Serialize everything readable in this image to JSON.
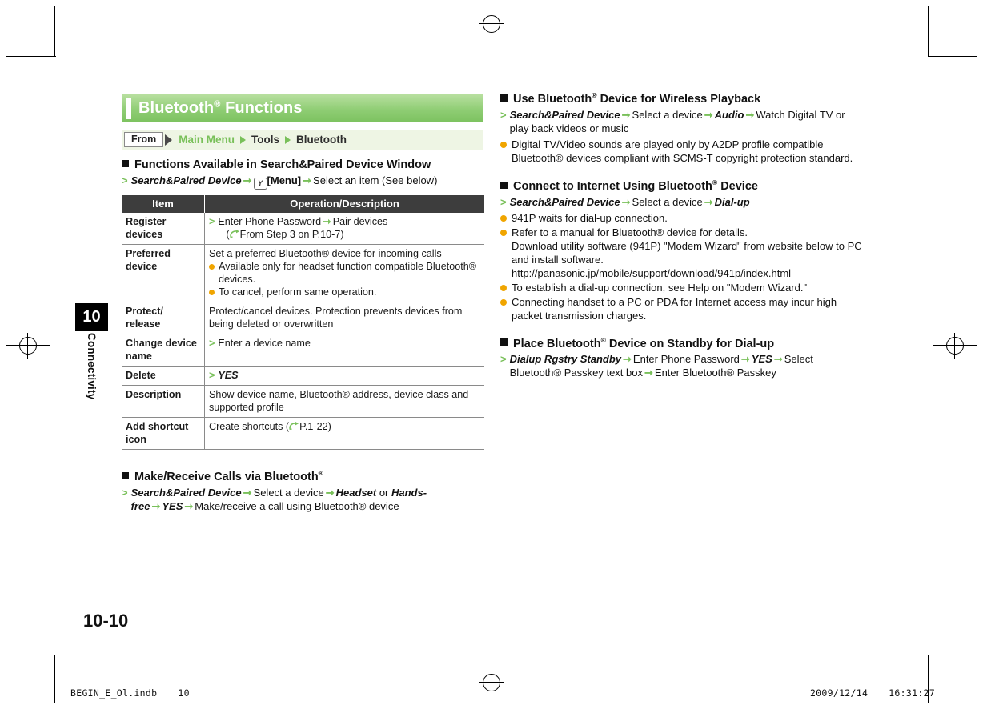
{
  "header": {
    "title": "Bluetooth",
    "title_sup": "®",
    "title_tail": " Functions"
  },
  "from_bar": {
    "label": "From",
    "path_1": "Main Menu",
    "path_2": "Tools",
    "path_3": "Bluetooth"
  },
  "side_tab": {
    "chapter_number": "10",
    "chapter_label": "Connectivity"
  },
  "left": {
    "heading_1": "Functions Available in Search&Paired Device Window",
    "step_1": {
      "bold_italic": "Search&Paired Device",
      "icon": "menu-key-icon",
      "menu_label": "[Menu]",
      "tail": "Select an item (See below)"
    },
    "table": {
      "headers": [
        "Item",
        "Operation/Description"
      ],
      "rows": [
        {
          "item": "Register devices",
          "desc_type": "step",
          "desc": "Enter Phone Password",
          "desc_tail": "Pair devices",
          "desc_ref": "From Step 3 on P.10-7)"
        },
        {
          "item": "Preferred device",
          "desc_type": "text-bullets",
          "desc": "Set a preferred Bluetooth® device for incoming calls",
          "bullets": [
            "Available only for headset function compatible Bluetooth® devices.",
            "To cancel, perform same operation."
          ]
        },
        {
          "item": "Protect/ release",
          "desc_type": "text",
          "desc": "Protect/cancel devices. Protection prevents devices from being deleted or overwritten"
        },
        {
          "item": "Change device name",
          "desc_type": "step-simple",
          "desc": "Enter a device name"
        },
        {
          "item": "Delete",
          "desc_type": "step-bolditalic",
          "desc": "YES"
        },
        {
          "item": "Description",
          "desc_type": "text",
          "desc": "Show device name, Bluetooth® address, device class and supported profile"
        },
        {
          "item": "Add shortcut icon",
          "desc_type": "text-ref",
          "desc": "Create shortcuts (",
          "desc_ref": "P.1-22)"
        }
      ]
    },
    "heading_2": "Make/Receive Calls via Bluetooth",
    "heading_2_sup": "®",
    "step_2": {
      "bold_italic": "Search&Paired Device",
      "mid": "Select a device",
      "opt_1": "Headset",
      "or": "or",
      "opt_2": "Hands-free",
      "opt_3": "YES",
      "tail": "Make/receive a call using Bluetooth® device"
    }
  },
  "right": {
    "heading_1": "Use Bluetooth",
    "heading_1_sup": "®",
    "heading_1_tail": " Device for Wireless Playback",
    "step_1": {
      "bold_italic": "Search&Paired Device",
      "mid": "Select a device",
      "opt": "Audio",
      "tail": "Watch Digital TV or play back videos or music"
    },
    "bullet_1": "Digital TV/Video sounds are played only by A2DP profile compatible Bluetooth® devices compliant with SCMS-T copyright protection standard.",
    "heading_2": "Connect to Internet Using Bluetooth",
    "heading_2_sup": "®",
    "heading_2_tail": " Device",
    "step_2": {
      "bold_italic": "Search&Paired Device",
      "mid": "Select a device",
      "opt": "Dial-up"
    },
    "bullet_2": "941P waits for dial-up connection.",
    "bullet_3_line1": "Refer to a manual for Bluetooth® device for details.",
    "bullet_3_line2": "Download utility software (941P) \"Modem Wizard\" from website below to PC and install software.",
    "bullet_3_line3": "http://panasonic.jp/mobile/support/download/941p/index.html",
    "bullet_4": "To establish a dial-up connection, see Help on \"Modem Wizard.\"",
    "bullet_5": "Connecting handset to a PC or PDA for Internet access may incur high packet transmission charges.",
    "heading_3": "Place Bluetooth",
    "heading_3_sup": "®",
    "heading_3_tail": " Device on Standby for Dial-up",
    "step_3": {
      "bold_italic": "Dialup Rgstry Standby",
      "mid": "Enter Phone Password",
      "opt": "YES",
      "tail_1": "Select Bluetooth® Passkey text box",
      "tail_2": "Enter Bluetooth® Passkey"
    }
  },
  "page_number": "10-10",
  "footer": {
    "left_file": "BEGIN_E_Ol.indb",
    "left_page": "10",
    "right_date": "2009/12/14",
    "right_time": "16:31:27"
  },
  "colors": {
    "accent_green": "#79c05a",
    "title_bar_green": "#8fcd74",
    "from_bar_bg": "#eef5e4",
    "bullet_orange": "#f0a500",
    "table_header_bg": "#3d3d3d"
  }
}
